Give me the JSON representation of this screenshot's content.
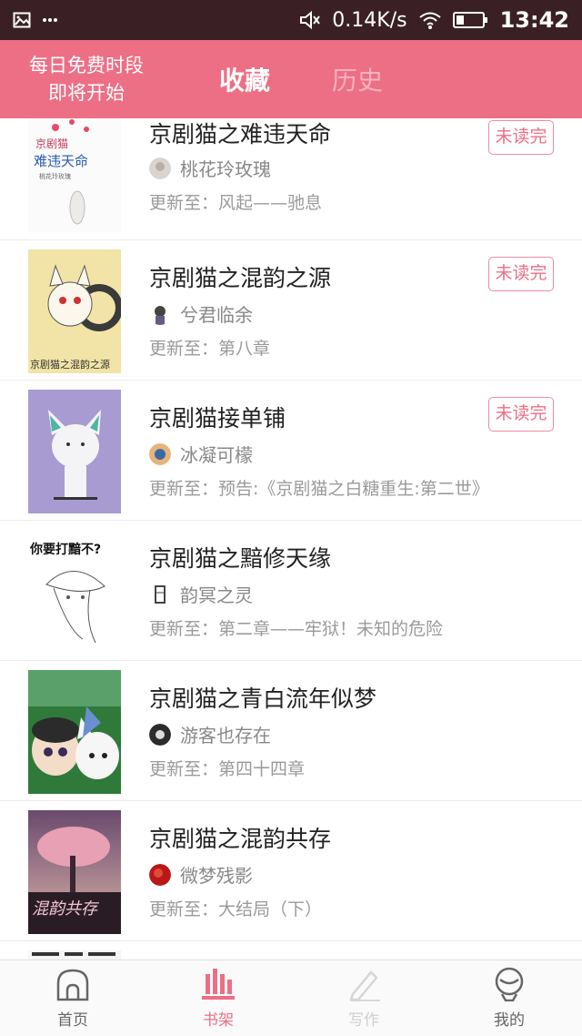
{
  "status_bar": {
    "network_speed": "0.14K/s",
    "time": "13:42"
  },
  "header": {
    "promo_line1": "每日免费时段",
    "promo_line2": "即将开始",
    "tabs": [
      {
        "label": "收藏",
        "active": true
      },
      {
        "label": "历史",
        "active": false
      }
    ]
  },
  "books": [
    {
      "title": "京剧猫之难违天命",
      "author": "桃花玲玫瑰",
      "update": "更新至：风起——驰息",
      "badge": "未读完",
      "cover_text": "京剧猫 难违天命"
    },
    {
      "title": "京剧猫之混韵之源",
      "author": "兮君临余",
      "update": "更新至：第八章",
      "badge": "未读完",
      "cover_text": "京剧猫之混韵之源"
    },
    {
      "title": "京剧猫接单铺",
      "author": "冰凝可檬",
      "update": "更新至：预告:《京剧猫之白糖重生:第二世》",
      "badge": "未读完",
      "cover_text": ""
    },
    {
      "title": "京剧猫之黯修天缘",
      "author": "韵冥之灵",
      "update": "更新至：第二章——牢狱！未知的危险",
      "badge": "",
      "cover_text": "你要打黯不?"
    },
    {
      "title": "京剧猫之青白流年似梦",
      "author": "游客也存在",
      "update": "更新至：第四十四章",
      "badge": "",
      "cover_text": ""
    },
    {
      "title": "京剧猫之混韵共存",
      "author": "微梦残影",
      "update": "更新至：大结局（下）",
      "badge": "",
      "cover_text": "混韵共存"
    }
  ],
  "bottom_nav": [
    {
      "label": "首页",
      "icon": "home-icon",
      "state": "normal"
    },
    {
      "label": "书架",
      "icon": "bookshelf-icon",
      "state": "active"
    },
    {
      "label": "写作",
      "icon": "pen-icon",
      "state": "disabled"
    },
    {
      "label": "我的",
      "icon": "profile-icon",
      "state": "normal"
    }
  ],
  "colors": {
    "accent": "#ec6f86",
    "status_bar": "#3a2024"
  }
}
